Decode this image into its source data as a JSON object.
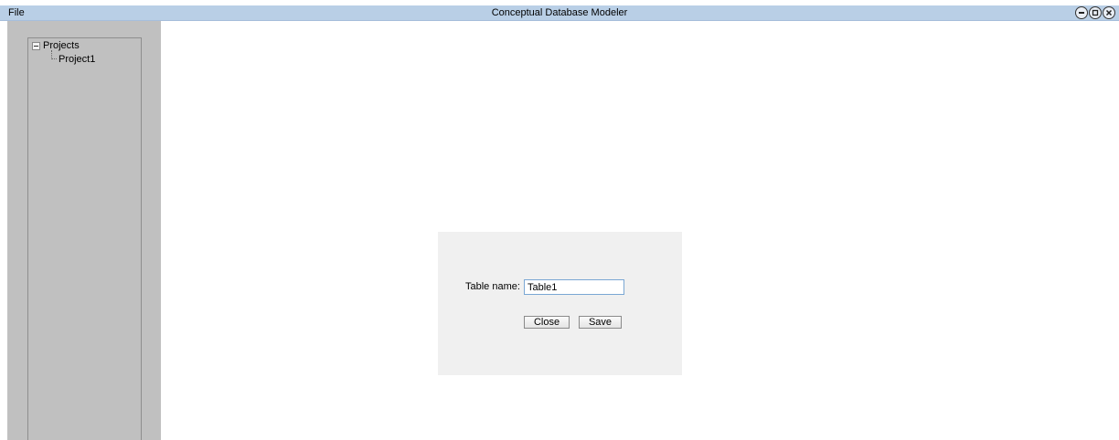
{
  "window": {
    "menu_file": "File",
    "title": "Conceptual Database Modeler",
    "controls": [
      "minimize-icon",
      "maximize-icon",
      "close-icon"
    ]
  },
  "tree": {
    "root_label": "Projects",
    "root_expanded": true,
    "children": [
      {
        "label": "Project1"
      }
    ]
  },
  "dialog": {
    "table_name_label": "Table name:",
    "table_name_value": "Table1",
    "close_label": "Close",
    "save_label": "Save"
  },
  "colors": {
    "titlebar": "#b9cfe6",
    "sidebar": "#c0c0c0",
    "dialog_bg": "#f0f0f0",
    "input_focus_border": "#7aa7d4"
  }
}
